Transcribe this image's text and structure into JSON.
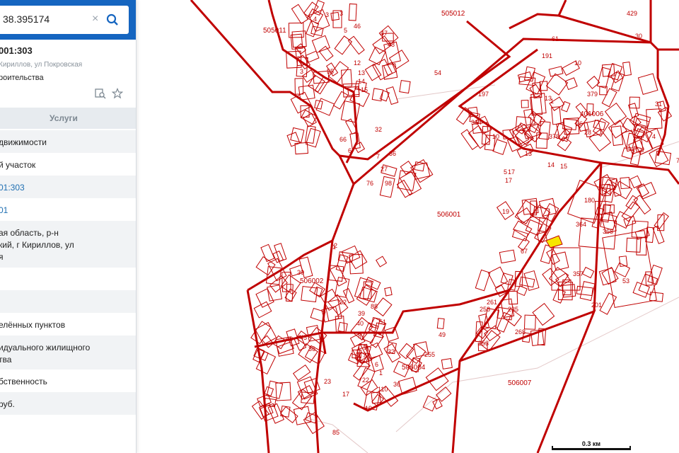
{
  "search": {
    "value": "38.395174"
  },
  "info": {
    "title": "001:303",
    "subtitle": "Кириллов, ул Покровская",
    "type": "роительства"
  },
  "tabs": {
    "services": "Услуги"
  },
  "rows": [
    "движимости",
    "й участок",
    "01:303",
    "01",
    "ая область, р-н\nкий, г Кириллов, ул\nя",
    "",
    "",
    "елённых пунктов",
    "идуального жилищного\nтва",
    "бственность",
    " руб.",
    ""
  ],
  "map": {
    "quarters": [
      "505011",
      "505012",
      "401006",
      "506001",
      "506002",
      "506004",
      "506007"
    ],
    "parcels": [
      "4",
      "3",
      "5",
      "46",
      "47",
      "48",
      "55",
      "12",
      "13",
      "14",
      "15",
      "54",
      "61",
      "191",
      "3",
      "10",
      "197",
      "13",
      "379",
      "1",
      "26",
      "28",
      "378",
      "31",
      "4",
      "17",
      "5",
      "14",
      "15",
      "19",
      "66",
      "6",
      "32",
      "364",
      "10",
      "27",
      "98",
      "76",
      "7",
      "36",
      "17",
      "13",
      "180",
      "364",
      "365",
      "357",
      "53",
      "201",
      "67",
      "1",
      "30",
      "32",
      "39",
      "40",
      "88",
      "51",
      "49",
      "255",
      "258",
      "261",
      "235",
      "268",
      "8",
      "9",
      "4",
      "32",
      "6",
      "1",
      "22",
      "110",
      "36",
      "23",
      "17",
      "19",
      "85",
      "45",
      "48",
      "36",
      "2",
      "253",
      "3",
      "429",
      "30",
      "7"
    ],
    "scale": "0.3 км"
  },
  "colors": {
    "boundary": "#c00000",
    "highlight": "#f7e600",
    "header": "#1565c0",
    "link": "#1f6fb2"
  }
}
